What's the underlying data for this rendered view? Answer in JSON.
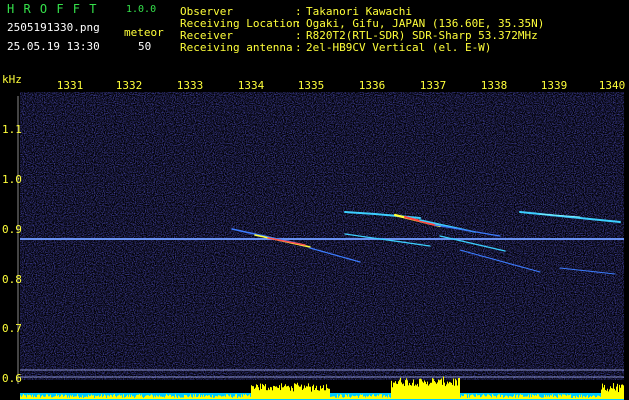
{
  "app": {
    "title": "H R O F F T",
    "version": "1.0.0"
  },
  "file": {
    "name": "2505191330.png",
    "datetime": "25.05.19 13:30"
  },
  "counter": {
    "label": "meteor",
    "value": "50"
  },
  "info": [
    {
      "label": "Observer",
      "sep": ":",
      "value": "Takanori Kawachi"
    },
    {
      "label": "Receiving Location",
      "sep": ":",
      "value": "Ogaki, Gifu, JAPAN (136.60E, 35.35N)"
    },
    {
      "label": "Receiver",
      "sep": ":",
      "value": "R820T2(RTL-SDR) SDR-Sharp 53.372MHz"
    },
    {
      "label": "Receiving antenna",
      "sep": ":",
      "value": "2el-HB9CV Vertical (el. E-W)"
    }
  ],
  "axis": {
    "y_unit": "kHz",
    "x_ticks": [
      "1331",
      "1332",
      "1333",
      "1334",
      "1335",
      "1336",
      "1337",
      "1338",
      "1339",
      "1340"
    ],
    "y_ticks": [
      "1.1",
      "1.0",
      "0.9",
      "0.8",
      "0.7",
      "0.6"
    ]
  },
  "colors": {
    "background": "#000000",
    "noise": "#15155e",
    "carrier": "#5a8cff",
    "echo_core": "#ff5050",
    "echo_edge": "#ffff3a",
    "axis_text": "#ffff3a",
    "header_green": "#34e04a",
    "bottom_fill": "#00c8ff",
    "bottom_peaks": "#ffff00"
  }
}
